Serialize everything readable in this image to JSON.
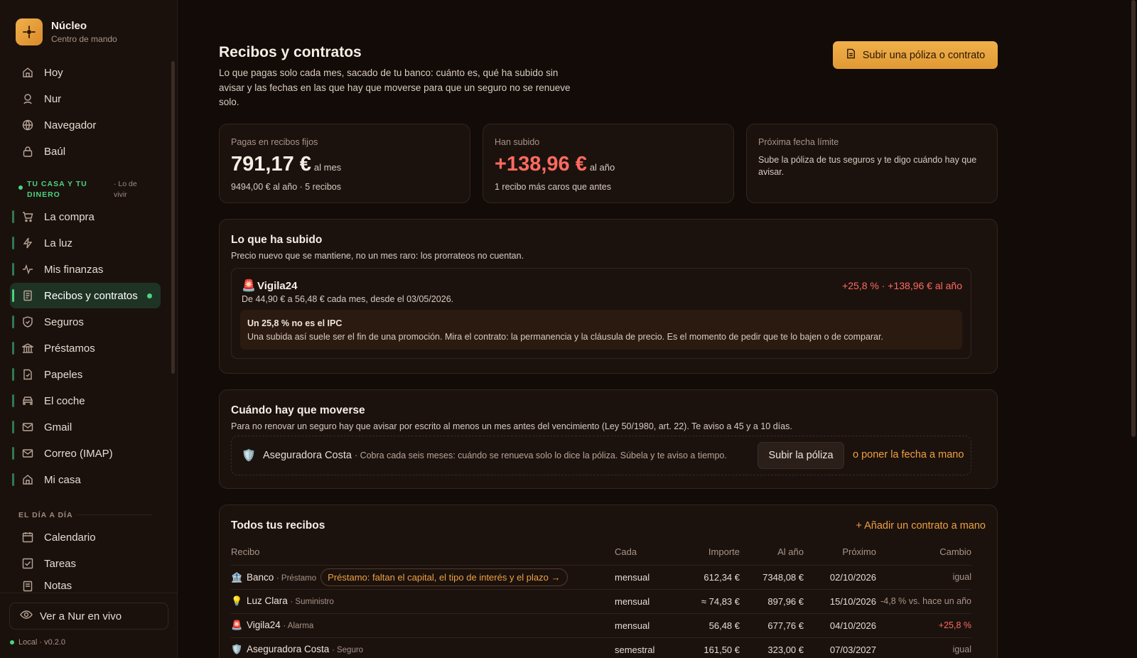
{
  "app": {
    "name": "Núcleo",
    "subtitle": "Centro de mando",
    "version": "Local · v0.2.0",
    "live_button": "Ver a Nur en vivo"
  },
  "sidebar": {
    "top_items": [
      {
        "label": "Hoy",
        "icon": "home-icon"
      },
      {
        "label": "Nur",
        "icon": "user-icon"
      },
      {
        "label": "Navegador",
        "icon": "globe-icon"
      },
      {
        "label": "Baúl",
        "icon": "lock-icon"
      }
    ],
    "section_home": {
      "title": "TU CASA Y TU DINERO",
      "subtitle": "· Lo de vivir"
    },
    "home_items": [
      {
        "label": "La compra",
        "icon": "cart-icon"
      },
      {
        "label": "La luz",
        "icon": "lightning-icon"
      },
      {
        "label": "Mis finanzas",
        "icon": "activity-icon"
      },
      {
        "label": "Recibos y contratos",
        "icon": "receipt-icon",
        "active": true
      },
      {
        "label": "Seguros",
        "icon": "shield-icon"
      },
      {
        "label": "Préstamos",
        "icon": "bank-icon"
      },
      {
        "label": "Papeles",
        "icon": "document-icon"
      },
      {
        "label": "El coche",
        "icon": "car-icon"
      },
      {
        "label": "Gmail",
        "icon": "mail-icon"
      },
      {
        "label": "Correo (IMAP)",
        "icon": "mail-icon"
      },
      {
        "label": "Mi casa",
        "icon": "house-icon"
      }
    ],
    "section_day": {
      "title": "EL DÍA A DÍA"
    },
    "day_items": [
      {
        "label": "Calendario",
        "icon": "calendar-icon"
      },
      {
        "label": "Tareas",
        "icon": "checkbox-icon"
      },
      {
        "label": "Notas",
        "icon": "note-icon"
      }
    ]
  },
  "header": {
    "title": "Recibos y contratos",
    "description": "Lo que pagas solo cada mes, sacado de tu banco: cuánto es, qué ha subido sin avisar y las fechas en las que hay que moverse para que un seguro no se renueve solo.",
    "upload_button": "Subir una póliza o contrato"
  },
  "stats": {
    "fixed": {
      "label": "Pagas en recibos fijos",
      "value": "791,17 €",
      "unit": "al mes",
      "sub": "9494,00 € al año · 5 recibos"
    },
    "rises": {
      "label": "Han subido",
      "value": "+138,96 €",
      "unit": "al año",
      "sub": "1 recibo más caros que antes"
    },
    "deadline": {
      "label": "Próxima fecha límite",
      "text": "Sube la póliza de tus seguros y te digo cuándo hay que avisar."
    }
  },
  "risen": {
    "title": "Lo que ha subido",
    "description": "Precio nuevo que se mantiene, no un mes raro: los prorrateos no cuentan.",
    "item": {
      "emoji": "🚨",
      "name": "Vigila24",
      "detail": "De 44,90 € a 56,48 € cada mes, desde el 03/05/2026.",
      "change": "+25,8 % · +138,96 € al año",
      "warn_title": "Un 25,8 % no es el IPC",
      "warn_text": "Una subida así suele ser el fin de una promoción. Mira el contrato: la permanencia y la cláusula de precio. Es el momento de pedir que te lo bajen o de comparar."
    }
  },
  "move": {
    "title": "Cuándo hay que moverse",
    "description": "Para no renovar un seguro hay que avisar por escrito al menos un mes antes del vencimiento (Ley 50/1980, art. 22). Te aviso a 45 y a 10 días.",
    "item": {
      "emoji": "🛡️",
      "name": "Aseguradora Costa",
      "note": "· Cobra cada seis meses: cuándo se renueva solo lo dice la póliza. Súbela y te aviso a tiempo.",
      "button": "Subir la póliza",
      "link": "o poner la fecha a mano"
    }
  },
  "receipts": {
    "title": "Todos tus recibos",
    "add_link": "+ Añadir un contrato a mano",
    "columns": [
      "Recibo",
      "Cada",
      "Importe",
      "Al año",
      "Próximo",
      "Cambio"
    ],
    "rows": [
      {
        "emoji": "🏦",
        "name": "Banco",
        "type": "· Préstamo",
        "pill": "Préstamo: faltan el capital, el tipo de interés y el plazo →",
        "every": "mensual",
        "amount": "612,34 €",
        "year": "7348,08 €",
        "next": "02/10/2026",
        "change": "igual",
        "change_color": "neutral"
      },
      {
        "emoji": "💡",
        "name": "Luz Clara",
        "type": "· Suministro",
        "pill": "",
        "every": "mensual",
        "amount": "≈ 74,83 €",
        "year": "897,96 €",
        "next": "15/10/2026",
        "change": "-4,8 % vs. hace un año",
        "change_color": "neutral"
      },
      {
        "emoji": "🚨",
        "name": "Vigila24",
        "type": "· Alarma",
        "pill": "",
        "every": "mensual",
        "amount": "56,48 €",
        "year": "677,76 €",
        "next": "04/10/2026",
        "change": "+25,8 %",
        "change_color": "red"
      },
      {
        "emoji": "🛡️",
        "name": "Aseguradora Costa",
        "type": "· Seguro",
        "pill": "",
        "every": "semestral",
        "amount": "161,50 €",
        "year": "323,00 €",
        "next": "07/03/2027",
        "change": "igual",
        "change_color": "neutral"
      }
    ]
  },
  "colors": {
    "accent": "#f0a040",
    "active_green": "#4cd37e",
    "rise_red": "#ff6a5f"
  }
}
